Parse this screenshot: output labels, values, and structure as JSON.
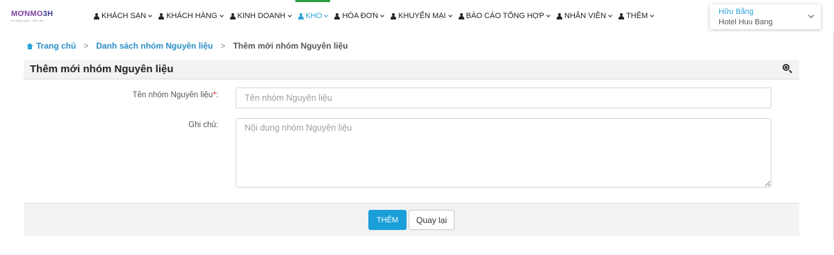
{
  "brand": {
    "logo_text_a": "MƠNMO",
    "logo_text_b": "3H",
    "tagline": "tài sáng nghề - lãnh thế"
  },
  "nav": {
    "items": [
      {
        "label": "KHÁCH SẠN",
        "icon": "user-icon",
        "active": false
      },
      {
        "label": "KHÁCH HÀNG",
        "icon": "user-icon",
        "active": false
      },
      {
        "label": "KINH DOANH",
        "icon": "user-icon",
        "active": false
      },
      {
        "label": "KHO",
        "icon": "user-icon",
        "active": true
      },
      {
        "label": "HÓA ĐƠN",
        "icon": "user-icon",
        "active": false
      },
      {
        "label": "KHUYẾN MẠI",
        "icon": "user-icon",
        "active": false
      },
      {
        "label": "BÁO CÁO TỔNG HỢP",
        "icon": "user-icon",
        "active": false
      },
      {
        "label": "NHÂN VIÊN",
        "icon": "user-icon",
        "active": false
      },
      {
        "label": "THÊM",
        "icon": "user-icon",
        "active": false
      }
    ],
    "active_color": "#2aa3d8",
    "active_indicator_color": "#2e9e3e"
  },
  "account": {
    "user_name": "Hữu Bằng",
    "hotel_name": "Hotel Huu Bang"
  },
  "breadcrumb": {
    "home": "Trang chủ",
    "list": "Danh sách nhóm Nguyên liệu",
    "current": "Thêm mới nhóm Nguyên liệu",
    "separator": ">"
  },
  "form": {
    "title": "Thêm mới nhóm Nguyên liệu",
    "name_label": "Tên nhóm Nguyên liệu",
    "required_mark": "*",
    "name_label_suffix": ":",
    "name_placeholder": "Tên nhóm Nguyên liệu",
    "name_value": "",
    "note_label": "Ghi chú:",
    "note_placeholder": "Nội dung nhóm Nguyên liệu",
    "note_value": "",
    "add_button": "THÊM",
    "back_button": "Quay lại",
    "primary_color": "#1a9fd9"
  }
}
